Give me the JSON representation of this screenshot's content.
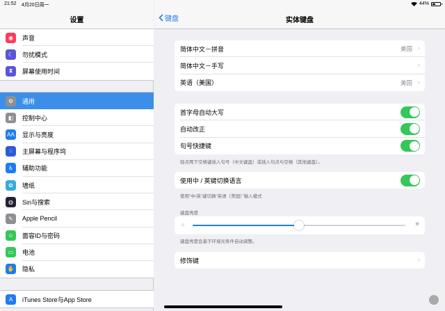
{
  "status": {
    "time": "21:52",
    "date": "4月20日周一",
    "battery": "44%",
    "battery_level": 0.44
  },
  "sidebar": {
    "title": "设置",
    "group1": [
      {
        "label": "声音",
        "icon": "speaker-icon",
        "color": "#ff3b5c",
        "glyph": "◉"
      },
      {
        "label": "勿扰模式",
        "icon": "moon-icon",
        "color": "#5856d6",
        "glyph": "☾"
      },
      {
        "label": "屏幕使用时间",
        "icon": "hourglass-icon",
        "color": "#5856d6",
        "glyph": "⧗"
      }
    ],
    "group2": [
      {
        "label": "通用",
        "icon": "gear-icon",
        "color": "#8e8e93",
        "glyph": "⚙",
        "active": true
      },
      {
        "label": "控制中心",
        "icon": "control-center-icon",
        "color": "#8e8e93",
        "glyph": "◧"
      },
      {
        "label": "显示与亮度",
        "icon": "display-icon",
        "color": "#1e7cf2",
        "glyph": "AA"
      },
      {
        "label": "主屏幕与程序坞",
        "icon": "home-screen-icon",
        "color": "#2c5cd6",
        "glyph": "⁙"
      },
      {
        "label": "辅助功能",
        "icon": "accessibility-icon",
        "color": "#1e7cf2",
        "glyph": "♿"
      },
      {
        "label": "墙纸",
        "icon": "wallpaper-icon",
        "color": "#35aadc",
        "glyph": "✿"
      },
      {
        "label": "Siri与搜索",
        "icon": "siri-icon",
        "color": "#222233",
        "glyph": "◍"
      },
      {
        "label": "Apple Pencil",
        "icon": "pencil-icon",
        "color": "#8e8e93",
        "glyph": "✎"
      },
      {
        "label": "面容ID与密码",
        "icon": "face-id-icon",
        "color": "#34c759",
        "glyph": "☺"
      },
      {
        "label": "电池",
        "icon": "battery-setting-icon",
        "color": "#34c759",
        "glyph": "▭"
      },
      {
        "label": "隐私",
        "icon": "hand-icon",
        "color": "#1e7cf2",
        "glyph": "✋"
      }
    ],
    "group3": [
      {
        "label": "iTunes Store与App Store",
        "icon": "app-store-icon",
        "color": "#1e7cf2",
        "glyph": "A"
      }
    ]
  },
  "main": {
    "back_label": "键盘",
    "title": "实体键盘",
    "layouts": [
      {
        "label": "简体中文－拼音",
        "value": "美国"
      },
      {
        "label": "简体中文－手写",
        "value": ""
      },
      {
        "label": "英语（美国）",
        "value": "美国"
      }
    ],
    "toggles": [
      {
        "label": "首字母自动大写",
        "on": true
      },
      {
        "label": "自动改正",
        "on": true
      },
      {
        "label": "句号快捷键",
        "on": true
      }
    ],
    "toggles_footer": "轻点两下空格键插入句号（中文键盘）或插入句点与空格（其他键盘）。",
    "switch_lang": {
      "label": "使用中 / 英键切换语言",
      "on": true
    },
    "switch_lang_footer": "使用“中/英”键切换“英语（美国）”输入模式",
    "brightness_header": "键盘亮度",
    "brightness_level": 0.5,
    "brightness_footer": "键盘亮度会基于环境光条件自动调整。",
    "modifier_label": "修饰键"
  }
}
